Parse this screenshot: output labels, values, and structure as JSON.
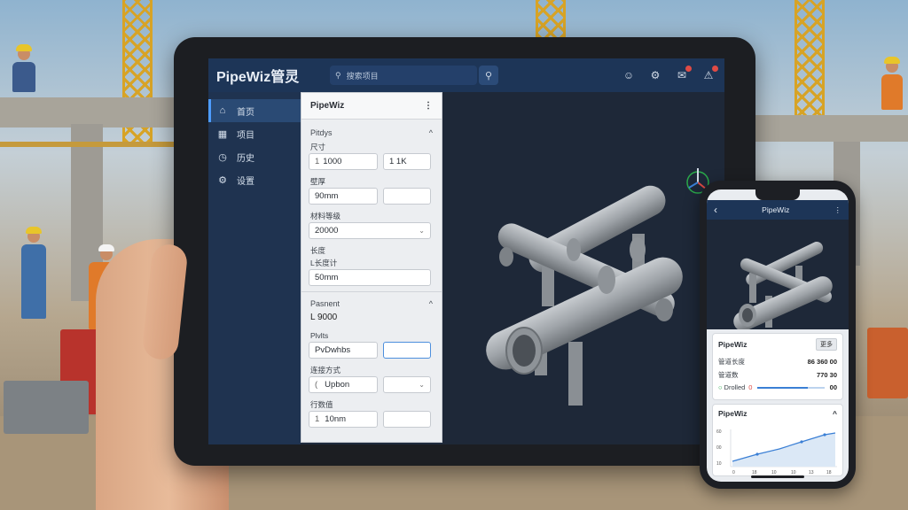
{
  "tablet_app": {
    "brand": "PipeWiz管灵",
    "search": {
      "placeholder": "搜索项目"
    },
    "top_icons": [
      "user-icon",
      "settings-icon",
      "bell-icon",
      "alert-icon"
    ],
    "sidebar": {
      "items": [
        {
          "icon": "home-icon",
          "label": "首页",
          "active": true
        },
        {
          "icon": "grid-icon",
          "label": "项目"
        },
        {
          "icon": "clock-icon",
          "label": "历史"
        },
        {
          "icon": "gear-icon",
          "label": "设置"
        }
      ]
    },
    "panel": {
      "title": "PipeWiz",
      "menu_glyph": "⋮",
      "section1": {
        "title": "Pitdys",
        "collapse_glyph": "^"
      },
      "label_a": "尺寸",
      "field_a1": "1000",
      "field_a1_prefix": "1",
      "field_a2": "1 1K",
      "label_b": "壁厚",
      "field_b1": "90mm",
      "field_b2": "",
      "label_c": "材料等级",
      "select_c": "20000",
      "label_d": "长度",
      "label_e": "L长度计",
      "field_e": "50mm",
      "section2": {
        "title": "Pasnent",
        "collapse_glyph": "^"
      },
      "value_f": "L 9000",
      "label_g": "Plvlts",
      "field_g1": "PvDwhbs",
      "field_g2": "",
      "label_h": "连接方式",
      "field_h": "Upbon",
      "field_h_prefix": "(",
      "select_h": "",
      "label_i": "行数值",
      "field_i": "10nm",
      "field_i_prefix": "1"
    }
  },
  "phone_app": {
    "title": "PipeWiz",
    "back_glyph": "‹",
    "menu_glyph": "⋮",
    "card1": {
      "title": "PipeWiz",
      "button": "更多",
      "rows": [
        {
          "label": "管道长度",
          "value": "86 360 00"
        },
        {
          "label": "管道数",
          "value": "770 30"
        },
        {
          "label": "Drolled",
          "value": "00",
          "marker": "0",
          "slider": 0.75
        }
      ]
    },
    "card2": {
      "title": "PipeWiz",
      "collapse_glyph": "^",
      "chart_ticks_y": [
        "60",
        "00",
        "10"
      ],
      "chart_ticks_x": [
        "0",
        "18",
        "10",
        "10",
        "13",
        "18"
      ]
    }
  },
  "colors": {
    "topbar": "#1d3557",
    "sidebar": "#1f3350",
    "viewport": "#1e2838",
    "accent": "#4d9cff",
    "pipe": "#9ea3a8"
  }
}
